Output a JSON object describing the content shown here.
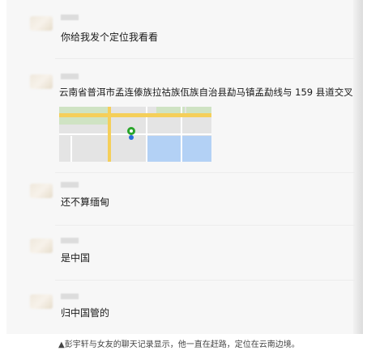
{
  "messages": [
    {
      "text": "你给我发个定位我看看"
    },
    {
      "text": "云南省普洱市孟连傣族拉祜族佤族自治县勐马镇孟勐线与 159 县道交叉",
      "type": "location"
    },
    {
      "text": "还不算缅甸"
    },
    {
      "text": "是中国"
    },
    {
      "text": "归中国管的"
    }
  ],
  "caption": "▲彭宇轩与女友的聊天记录显示，他一直在赶路，定位在云南边境。",
  "colors": {
    "panel": "#f7f7f7",
    "road": "#f5cf5a",
    "water": "#b3d1f5",
    "park": "#cfe3c3",
    "pin": "#2aa52a",
    "dot": "#2a6fdb"
  }
}
